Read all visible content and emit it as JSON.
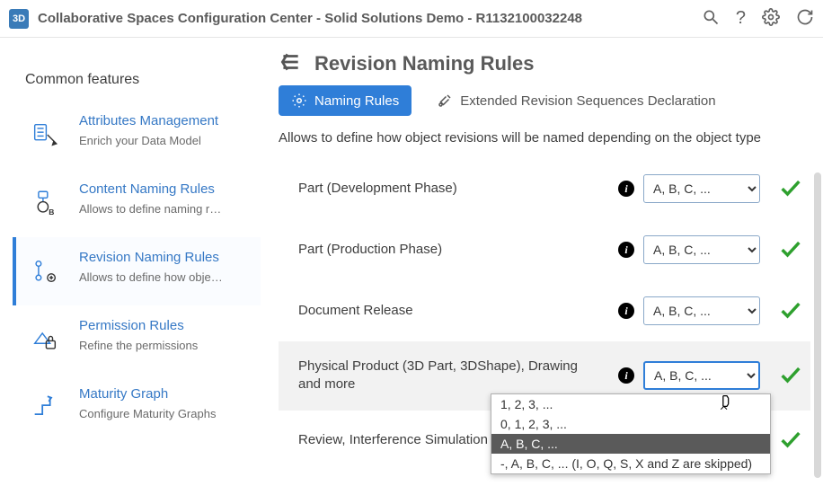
{
  "header": {
    "title": "Collaborative Spaces Configuration Center - Solid Solutions Demo - R1132100032248"
  },
  "sidebar": {
    "section_title": "Common features",
    "items": [
      {
        "title": "Attributes Management",
        "desc": "Enrich your Data Model"
      },
      {
        "title": "Content Naming Rules",
        "desc": "Allows to define naming r…"
      },
      {
        "title": "Revision Naming Rules",
        "desc": "Allows to define how obje…"
      },
      {
        "title": "Permission Rules",
        "desc": "Refine the permissions"
      },
      {
        "title": "Maturity Graph",
        "desc": "Configure Maturity Graphs"
      }
    ]
  },
  "page": {
    "title": "Revision Naming Rules",
    "tabs": {
      "naming": "Naming Rules",
      "extended": "Extended Revision Sequences Declaration"
    },
    "intro": "Allows to define how object revisions will be named depending on the object type",
    "rules": [
      {
        "label": "Part (Development Phase)",
        "value": "A, B, C, ..."
      },
      {
        "label": "Part (Production Phase)",
        "value": "A, B, C, ..."
      },
      {
        "label": "Document Release",
        "value": "A, B, C, ..."
      },
      {
        "label": "Physical Product (3D Part, 3DShape), Drawing and more",
        "value": "A, B, C, ..."
      },
      {
        "label": "Review, Interference Simulation and more",
        "value": "A, B, C, ..."
      }
    ],
    "dropdown_options": [
      "1, 2, 3, ...",
      "0, 1, 2, 3, ...",
      "A, B, C, ...",
      "-, A, B, C, ... (I, O, Q, S, X and Z are skipped)"
    ]
  }
}
